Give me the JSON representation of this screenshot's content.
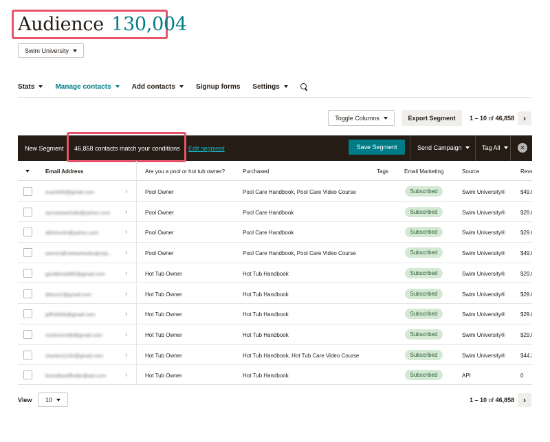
{
  "header": {
    "title_word": "Audience",
    "title_count": "130,004",
    "audience_select": "Swim University"
  },
  "nav": {
    "stats": "Stats",
    "manage_contacts": "Manage contacts",
    "add_contacts": "Add contacts",
    "signup_forms": "Signup forms",
    "settings": "Settings"
  },
  "toolbar": {
    "toggle_columns": "Toggle Columns",
    "export_segment": "Export Segment",
    "pager_range": "1 – 10",
    "pager_of": "of",
    "pager_total": "46,858",
    "next": "›"
  },
  "segment": {
    "new_segment": "New Segment",
    "match_text": "46,858 contacts match your conditions",
    "edit_segment": "Edit segment",
    "save_segment": "Save Segment",
    "send_campaign": "Send Campaign",
    "tag_all": "Tag All",
    "close": "✕"
  },
  "table": {
    "headers": {
      "email": "Email Address",
      "owner": "Are you a pool or hot tub owner?",
      "purchased": "Purchased",
      "tags": "Tags",
      "email_marketing": "Email Marketing",
      "source": "Source",
      "revenue": "Reve"
    },
    "rows": [
      {
        "email": "evanhill4@gmail.com",
        "owner": "Pool Owner",
        "purchased": "Pool Care Handbook, Pool Care Video Course",
        "status": "Subscribed",
        "source": "Swim University®",
        "revenue": "$49.0"
      },
      {
        "email": "eyrosewashalo@yahoo.com",
        "owner": "Pool Owner",
        "purchased": "Pool Care Handbook",
        "status": "Subscribed",
        "source": "Swim University®",
        "revenue": "$29.0"
      },
      {
        "email": "allinlncoln@yahoo.com",
        "owner": "Pool Owner",
        "purchased": "Pool Care Handbook",
        "status": "Subscribed",
        "source": "Swim University®",
        "revenue": "$29.0"
      },
      {
        "email": "warren@networkedsolproje...",
        "owner": "Pool Owner",
        "purchased": "Pool Care Handbook, Pool Care Video Course",
        "status": "Subscribed",
        "source": "Swim University®",
        "revenue": "$49.0"
      },
      {
        "email": "geoldonald85@gmail.com",
        "owner": "Hot Tub Owner",
        "purchased": "Hot Tub Handbook",
        "status": "Subscribed",
        "source": "Swim University®",
        "revenue": "$29.0"
      },
      {
        "email": "bbhurt1@gmail.com",
        "owner": "Hot Tub Owner",
        "purchased": "Hot Tub Handbook",
        "status": "Subscribed",
        "source": "Swim University®",
        "revenue": "$29.0"
      },
      {
        "email": "jeff18606@gmail.com",
        "owner": "Hot Tub Owner",
        "purchased": "Hot Tub Handbook",
        "status": "Subscribed",
        "source": "Swim University®",
        "revenue": "$29.0"
      },
      {
        "email": "mckeonm86@gmail.com",
        "owner": "Hot Tub Owner",
        "purchased": "Hot Tub Handbook",
        "status": "Subscribed",
        "source": "Swim University®",
        "revenue": "$29.0"
      },
      {
        "email": "charles1116r@gmail.com",
        "owner": "Hot Tub Owner",
        "purchased": "Hot Tub Handbook, Hot Tub Care Video Course",
        "status": "Subscribed",
        "source": "Swim University®",
        "revenue": "$44.2"
      },
      {
        "email": "bcondissoffinder@aol.com",
        "owner": "Hot Tub Owner",
        "purchased": "Hot Tub Handbook",
        "status": "Subscribed",
        "source": "API",
        "revenue": "0"
      }
    ]
  },
  "footer": {
    "view_label": "View",
    "view_value": "10",
    "pager_range": "1 – 10",
    "pager_of": "of",
    "pager_total": "46,858",
    "next": "›"
  },
  "colors": {
    "accent_teal": "#007c89",
    "highlight_red": "#e8536a",
    "segment_bar": "#241c15",
    "badge_green": "#d4e9d4"
  },
  "icons": [
    "chevron-down-icon",
    "search-icon",
    "chevron-right-icon",
    "close-icon"
  ]
}
